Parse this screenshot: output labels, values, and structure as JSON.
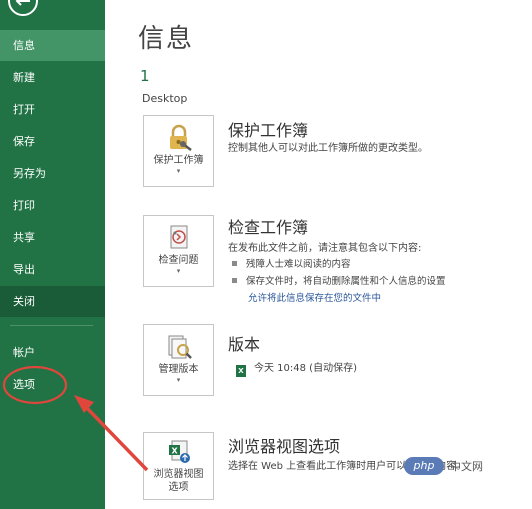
{
  "sidebar": {
    "back": "back-arrow-icon",
    "items": [
      {
        "label": "信息",
        "state": "selected"
      },
      {
        "label": "新建"
      },
      {
        "label": "打开"
      },
      {
        "label": "保存"
      },
      {
        "label": "另存为"
      },
      {
        "label": "打印"
      },
      {
        "label": "共享"
      },
      {
        "label": "导出"
      },
      {
        "label": "关闭",
        "state": "hover"
      },
      {
        "label": "帐户"
      },
      {
        "label": "选项"
      }
    ]
  },
  "main": {
    "title": "信息",
    "count": "1",
    "location": "Desktop",
    "protect": {
      "tile_label": "保护工作簿",
      "title": "保护工作簿",
      "desc": "控制其他人可以对此工作簿所做的更改类型。",
      "icon": "lock-key-icon"
    },
    "inspect": {
      "tile_label": "检查问题",
      "title": "检查工作簿",
      "desc": "在发布此文件之前，请注意其包含以下内容:",
      "bullets": [
        "残障人士难以阅读的内容",
        "保存文件时，将自动删除属性和个人信息的设置"
      ],
      "link": "允许将此信息保存在您的文件中",
      "icon": "inspect-document-icon"
    },
    "version": {
      "tile_label": "管理版本",
      "title": "版本",
      "entry": "今天 10:48 (自动保存)",
      "icon": "manage-versions-icon"
    },
    "browser": {
      "tile_label_line1": "浏览器视图",
      "tile_label_line2": "选项",
      "title": "浏览器视图选项",
      "desc": "选择在 Web 上查看此工作簿时用户可以看到的内容。",
      "icon": "browser-view-icon"
    }
  },
  "watermark": {
    "badge": "php",
    "text": "中文网"
  },
  "colors": {
    "sidebar": "#217346",
    "selected": "#439467",
    "annotation": "#e0463c",
    "link": "#2b579a"
  }
}
